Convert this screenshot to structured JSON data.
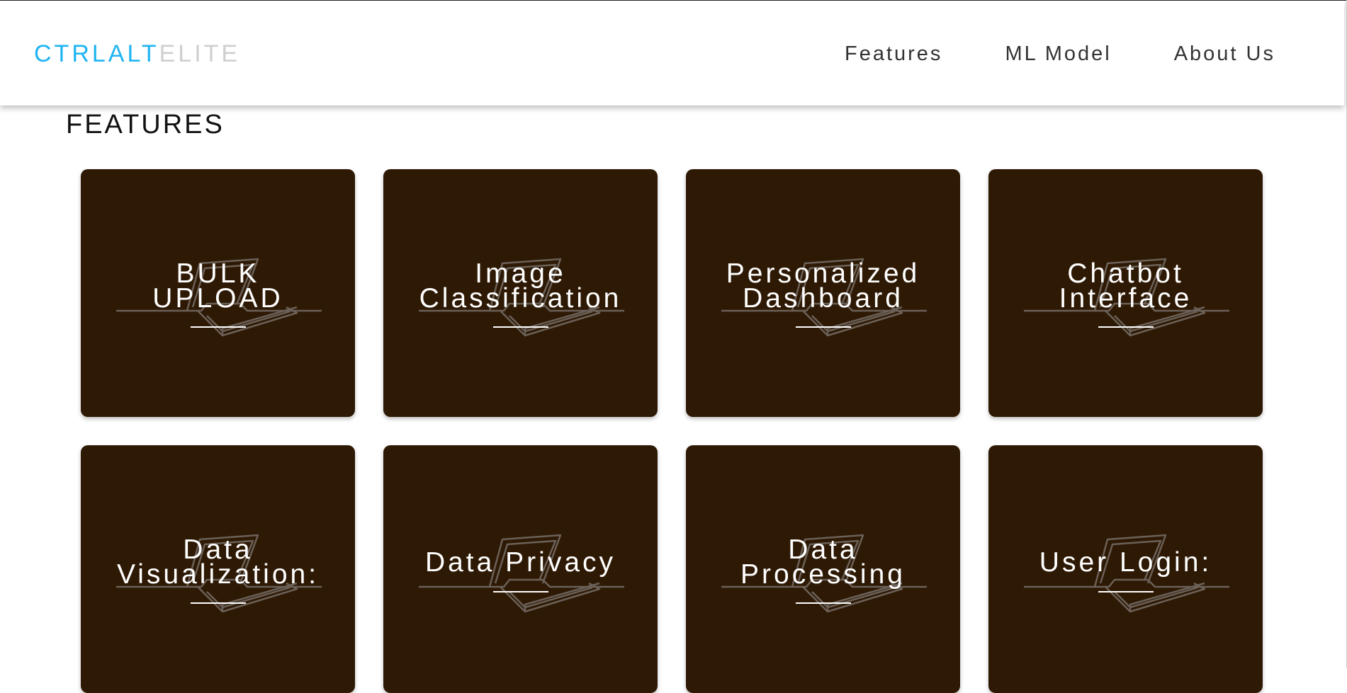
{
  "logo": {
    "primary": "CTRLALT",
    "secondary": "ELITE"
  },
  "nav": {
    "items": [
      {
        "label": "Features"
      },
      {
        "label": "ML Model"
      },
      {
        "label": "About Us"
      }
    ]
  },
  "features": {
    "title": "FEATURES",
    "cards": [
      {
        "lines": [
          "BULK",
          "UPLOAD"
        ]
      },
      {
        "lines": [
          "Image",
          "Classification"
        ]
      },
      {
        "lines": [
          "Personalized",
          "Dashboard"
        ]
      },
      {
        "lines": [
          "Chatbot",
          "Interface"
        ]
      },
      {
        "lines": [
          "Data",
          "Visualization:"
        ]
      },
      {
        "lines": [
          "Data Privacy"
        ]
      },
      {
        "lines": [
          "Data",
          "Processing"
        ]
      },
      {
        "lines": [
          "User Login:"
        ]
      }
    ]
  },
  "colors": {
    "brand_primary": "#1fb4f1",
    "brand_secondary": "#cfcfcf",
    "card_background": "#2e1904",
    "card_text": "#ffffff"
  },
  "icons": {
    "card_illustration": "laptop-outline-icon"
  }
}
